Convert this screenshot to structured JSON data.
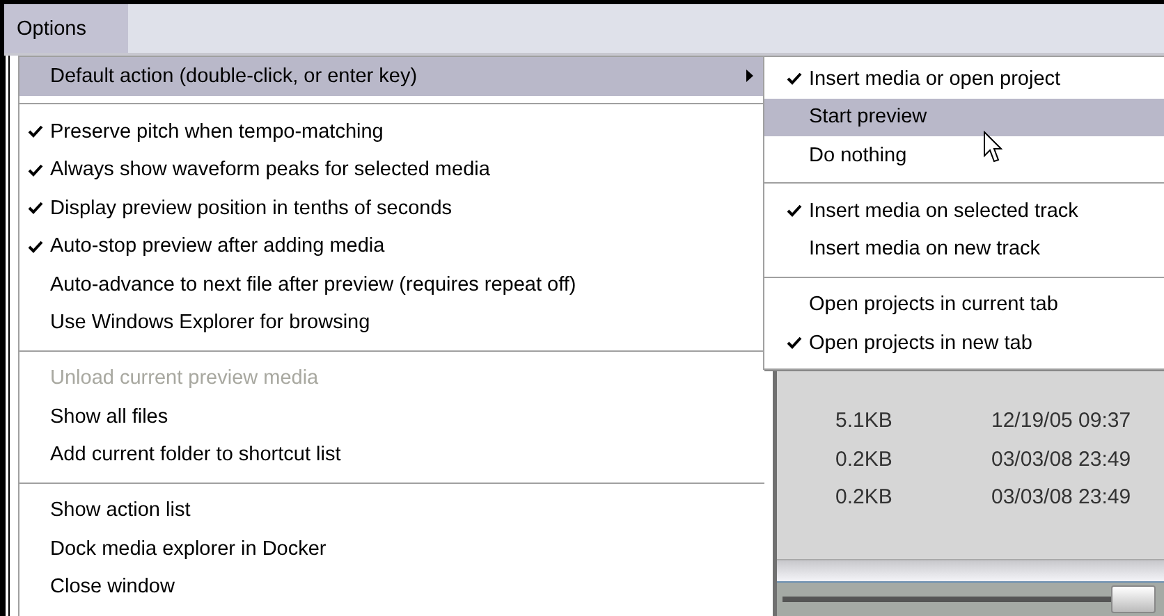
{
  "menubar": [
    {
      "label": "Options",
      "selected": true
    }
  ],
  "menu": {
    "items": [
      {
        "kind": "submenu",
        "label": "Default action (double-click, or enter key)",
        "selected": true
      },
      {
        "kind": "separator"
      },
      {
        "kind": "item",
        "label": "Preserve pitch when tempo-matching",
        "checked": true,
        "disabled": false,
        "selected": false
      },
      {
        "kind": "item",
        "label": "Always show waveform peaks for selected media",
        "checked": true,
        "disabled": false,
        "selected": false
      },
      {
        "kind": "item",
        "label": "Display preview position in tenths of seconds",
        "checked": true,
        "disabled": false,
        "selected": false
      },
      {
        "kind": "item",
        "label": "Auto-stop preview after adding media",
        "checked": true,
        "disabled": false,
        "selected": false
      },
      {
        "kind": "item",
        "label": "Auto-advance to next file after preview (requires repeat off)",
        "checked": false,
        "disabled": false,
        "selected": false
      },
      {
        "kind": "item",
        "label": "Use Windows Explorer for browsing",
        "checked": false,
        "disabled": false,
        "selected": false
      },
      {
        "kind": "separator"
      },
      {
        "kind": "item",
        "label": "Unload current preview media",
        "checked": false,
        "disabled": true,
        "selected": false
      },
      {
        "kind": "item",
        "label": "Show all files",
        "checked": false,
        "disabled": false,
        "selected": false
      },
      {
        "kind": "item",
        "label": "Add current folder to shortcut list",
        "checked": false,
        "disabled": false,
        "selected": false
      },
      {
        "kind": "separator"
      },
      {
        "kind": "item",
        "label": "Show action list",
        "checked": false,
        "disabled": false,
        "selected": false
      },
      {
        "kind": "item",
        "label": "Dock media explorer in Docker",
        "checked": false,
        "disabled": false,
        "selected": false
      },
      {
        "kind": "item",
        "label": "Close window",
        "checked": false,
        "disabled": false,
        "selected": false
      }
    ]
  },
  "submenu": {
    "items": [
      {
        "kind": "item",
        "label": "Insert media or open project",
        "checked": true,
        "disabled": false,
        "selected": false
      },
      {
        "kind": "item",
        "label": "Start preview",
        "checked": false,
        "disabled": false,
        "selected": true
      },
      {
        "kind": "item",
        "label": "Do nothing",
        "checked": false,
        "disabled": false,
        "selected": false
      },
      {
        "kind": "separator"
      },
      {
        "kind": "item",
        "label": "Insert media on selected track",
        "checked": true,
        "disabled": false,
        "selected": false
      },
      {
        "kind": "item",
        "label": "Insert media on new track",
        "checked": false,
        "disabled": false,
        "selected": false
      },
      {
        "kind": "separator"
      },
      {
        "kind": "item",
        "label": "Open projects in current tab",
        "checked": false,
        "disabled": false,
        "selected": false
      },
      {
        "kind": "item",
        "label": "Open projects in new tab",
        "checked": true,
        "disabled": false,
        "selected": false
      }
    ]
  },
  "file_list": {
    "rows": [
      {
        "size": "5.1KB",
        "date": "12/19/05 09:37"
      },
      {
        "size": "0.2KB",
        "date": "03/03/08 23:49"
      },
      {
        "size": "0.2KB",
        "date": "03/03/08 23:49"
      }
    ]
  }
}
